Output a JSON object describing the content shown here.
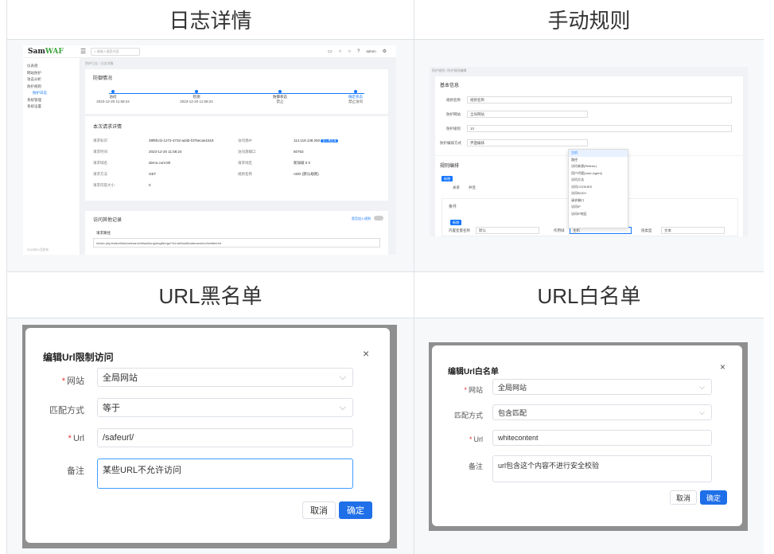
{
  "headers": {
    "log_detail": "日志详情",
    "manual_rules": "手动规则",
    "url_blacklist": "URL黑名单",
    "url_whitelist": "URL白名单"
  },
  "shot1": {
    "logo_main": "Sam",
    "logo_accent": "WAF",
    "search_placeholder": "请输入搜索内容",
    "user": "admin",
    "sidebar": [
      "仪表盘",
      "网站防护",
      "攻击分析",
      "防护规则",
      "防护日志",
      "系统管理",
      "系统设置"
    ],
    "version": "2023年1月发布",
    "breadcrumb": "防护日志 / 日志详情",
    "section1": "防御情况",
    "steps": [
      {
        "label": "访问",
        "time": "2023-12-20 11:58:24"
      },
      {
        "label": "检测",
        "time": "2023-12-20 11:58:24"
      },
      {
        "label": "防御状态",
        "time": "禁止"
      },
      {
        "label": "确定状态",
        "time": "禁止访问"
      }
    ],
    "section2": "本次请求详情",
    "fields": [
      {
        "k": "请求标识",
        "v": "39f5fccb-1272-4732-ad4b-f376ecae1618"
      },
      {
        "k": "请求时间",
        "v": "2023-12-20 11:58:24"
      },
      {
        "k": "请求域名",
        "v": "demo.com:80"
      },
      {
        "k": "请求方法",
        "v": "GET"
      },
      {
        "k": "请求内容大小",
        "v": "0"
      }
    ],
    "fields_right": [
      {
        "k": "访问源IP",
        "v": "114.119.138.250"
      },
      {
        "k": "访问源端口",
        "v": "50763"
      },
      {
        "k": "请求地区",
        "v": "新加坡 0 0"
      },
      {
        "k": "规则名称",
        "v": "ADD (默认规则)"
      }
    ],
    "ip_tag": "加入黑名单",
    "section3": "访问其他记录",
    "toggle_label": "是否加入规则",
    "sub_heading": "请求路径",
    "path": "/index.php/index/lists/cateranch/blacklung/english/go/?id=default&catename/url/white/red"
  },
  "shot2": {
    "breadcrumb": "防护规则 / 防护规则编辑",
    "section1": "基本信息",
    "labels": [
      "规则名称",
      "防护网站",
      "防护级别",
      "防护编排方式"
    ],
    "values": [
      "规则名称",
      "全局网站",
      "10",
      "界面编排"
    ],
    "section2": "规则编排",
    "add_button": "新增",
    "relation_label": "关系",
    "relation_value": "并且",
    "condition_heading": "条件",
    "condition_add": "新增",
    "cond_label1": "内置变量名称",
    "cond_value1": "默认",
    "operator_label": "作用域",
    "operator_value": "主机",
    "value_label": "值类型",
    "value_value": "文本",
    "dropdown_options": [
      "主机",
      "路径",
      "访问来源(Referer)",
      "用户代理(User-Agent)",
      "访问方法",
      "访问COOKIES",
      "访问BODY",
      "请求端口",
      "访问IP",
      "访问IP地区"
    ]
  },
  "dialog_black": {
    "title": "编辑Url限制访问",
    "close": "×",
    "site_label": "网站",
    "site_value": "全局网站",
    "match_label": "匹配方式",
    "match_value": "等于",
    "url_label": "Url",
    "url_value": "/safeurl/",
    "note_label": "备注",
    "note_value": "某些URL不允许访问",
    "cancel": "取消",
    "ok": "确定"
  },
  "dialog_white": {
    "title": "编辑Url白名单",
    "close": "×",
    "site_label": "网站",
    "site_value": "全局网站",
    "match_label": "匹配方式",
    "match_value": "包含匹配",
    "url_label": "Url",
    "url_value": "whitecontent",
    "note_label": "备注",
    "note_value": "url包含这个内容不进行安全校验",
    "cancel": "取消",
    "ok": "确定"
  }
}
